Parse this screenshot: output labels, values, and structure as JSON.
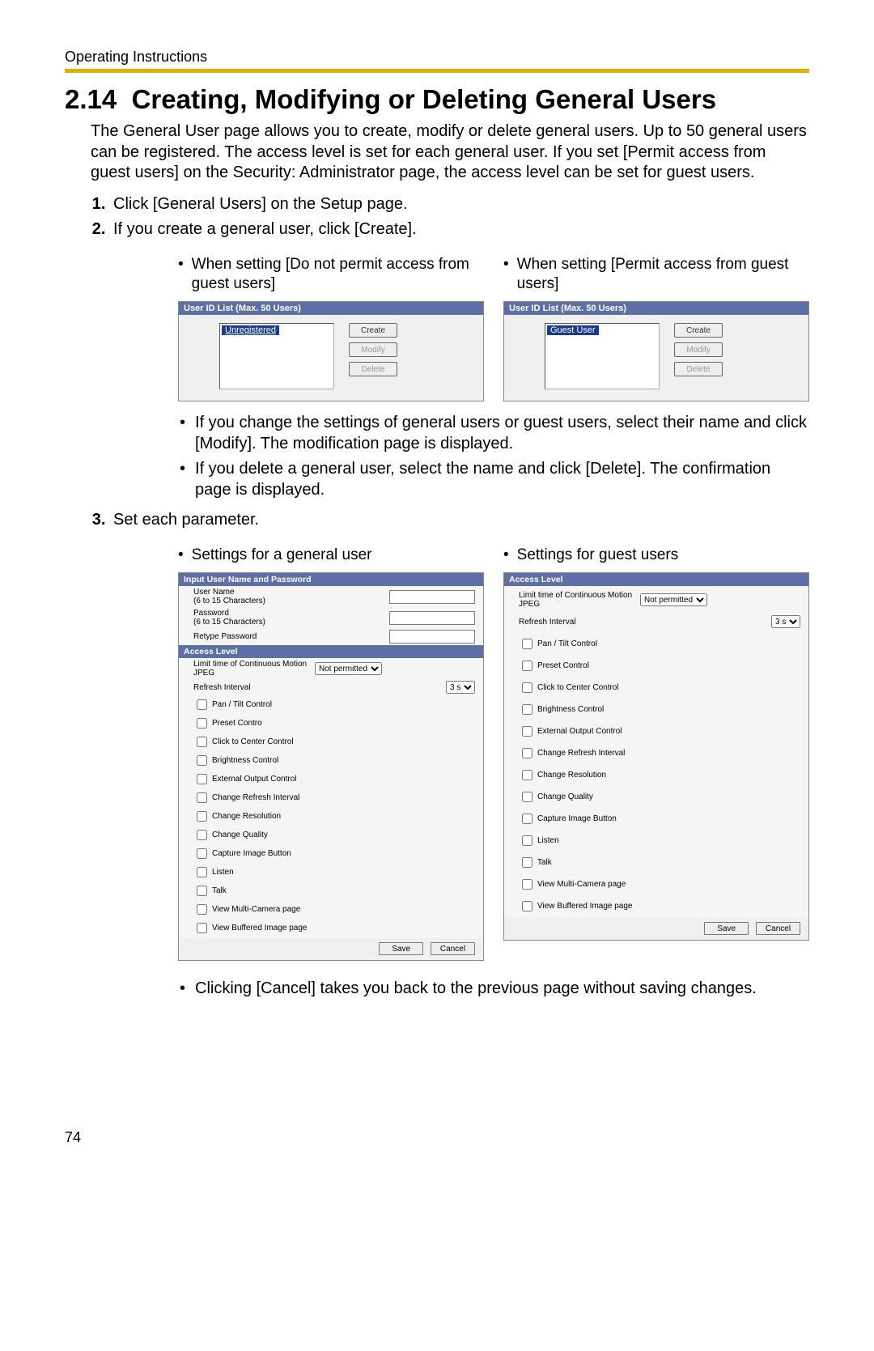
{
  "header": {
    "doc_title": "Operating Instructions"
  },
  "section": {
    "number": "2.14",
    "title": "Creating, Modifying or Deleting General Users",
    "intro": "The General User page allows you to create, modify or delete general users. Up to 50 general users can be registered. The access level is set for each general user. If you set [Permit access from guest users] on the Security: Administrator page, the access level can be set for guest users."
  },
  "steps": {
    "s1": "Click [General Users] on the Setup page.",
    "s2": "If you create a general user, click [Create].",
    "s3": "Set each parameter."
  },
  "s2_cols": {
    "left_caption": "When setting [Do not permit access from guest users]",
    "right_caption": "When setting [Permit access from guest users]"
  },
  "userlist_panel": {
    "title": "User ID List (Max. 50 Users)",
    "item_unreg": "Unregistered",
    "item_guest": "Guest User",
    "btn_create": "Create",
    "btn_modify": "Modify",
    "btn_delete": "Delete"
  },
  "s2_notes": {
    "n1": "If you change the settings of general users or guest users, select their name and click [Modify]. The modification page is displayed.",
    "n2": "If you delete a general user, select the name and click [Delete]. The confirmation page is displayed."
  },
  "s3_cols": {
    "left_caption": "Settings for a general user",
    "right_caption": "Settings for guest users"
  },
  "form": {
    "hd_userpw": "Input User Name and Password",
    "hd_access": "Access Level",
    "labels": {
      "username": "User Name",
      "username_hint": "(6 to 15 Characters)",
      "password": "Password",
      "password_hint": "(6 to 15 Characters)",
      "retype": "Retype Password",
      "limit": "Limit time of Continuous Motion JPEG",
      "refresh": "Refresh Interval"
    },
    "select_limit": "Not permitted",
    "select_refresh": "3 s",
    "checkboxes": [
      "Pan / Tilt Control",
      "Preset Control",
      "Click to Center Control",
      "Brightness Control",
      "External Output Control",
      "Change Refresh Interval",
      "Change Resolution",
      "Change Quality",
      "Capture Image Button",
      "Listen",
      "Talk",
      "View Multi-Camera page",
      "View Buffered Image page"
    ],
    "checkboxes_general": [
      "Pan / Tilt Control",
      "Preset Contro",
      "Click to Center Control",
      "Brightness Control",
      "External Output Control",
      "Change Refresh Interval",
      "Change Resolution",
      "Change Quality",
      "Capture Image Button",
      "Listen",
      "Talk",
      "View Multi-Camera page",
      "View Buffered Image page"
    ],
    "btn_save": "Save",
    "btn_cancel": "Cancel"
  },
  "s3_notes": {
    "n1": "Clicking [Cancel] takes you back to the previous page without saving changes."
  },
  "page_number": "74"
}
